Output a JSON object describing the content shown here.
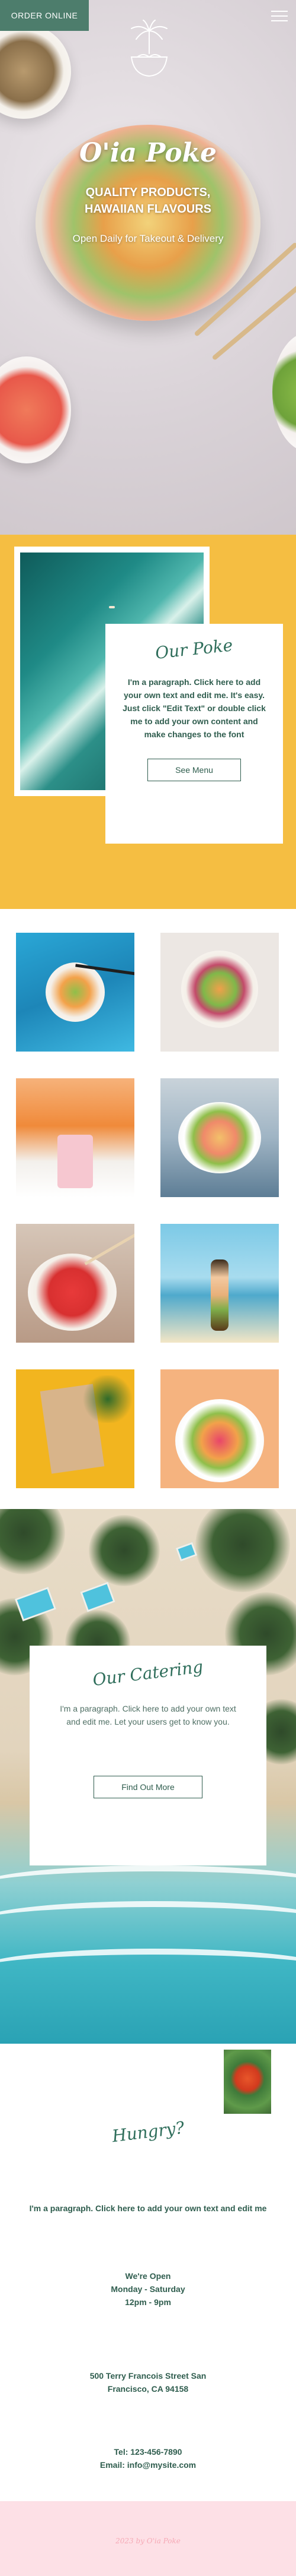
{
  "header": {
    "order_label": "ORDER ONLINE",
    "menu_icon": "hamburger-menu-icon",
    "logo_icon": "palm-bowl-logo-icon"
  },
  "hero": {
    "title": "O'ia Poke",
    "tagline_line1": "QUALITY PRODUCTS,",
    "tagline_line2": "HAWAIIAN FLAVOURS",
    "open_text": "Open Daily for Takeout & Delivery"
  },
  "our_poke": {
    "title": "Our Poke",
    "paragraph": "I'm a paragraph. Click here to add your own text and edit me. It's easy. Just click \"Edit Text\" or double click me to add your own content and make changes to the font",
    "button_label": "See Menu"
  },
  "gallery": {
    "images": [
      "chopsticks-bowl-blue-table",
      "poke-bowl-top-view",
      "bottle-bag-orange",
      "bowl-on-lap",
      "tuna-chopsticks",
      "hula-doll-beach",
      "takeout-bag-yellow",
      "poke-bowl-peach"
    ]
  },
  "catering": {
    "title": "Our Catering",
    "paragraph": "I'm a paragraph. Click here to add your own text and edit me. Let your users get to know you.",
    "button_label": "Find Out More"
  },
  "hungry": {
    "title": "Hungry?",
    "paragraph": "I'm a paragraph. Click here to add your own text and edit me",
    "hours_line1": "We're Open",
    "hours_line2": "Monday - Saturday",
    "hours_line3": "12pm - 9pm",
    "address_line1": "500 Terry Francois Street San",
    "address_line2": "Francisco, CA 94158",
    "tel": "Tel: 123-456-7890",
    "email": "Email: info@mysite.com"
  },
  "footer": {
    "text": "2023 by O'ia Poke"
  },
  "colors": {
    "brand_green": "#4d7d6c",
    "text_green": "#2f5d4e",
    "yellow": "#f5be42",
    "footer_pink": "#fde0e6"
  }
}
